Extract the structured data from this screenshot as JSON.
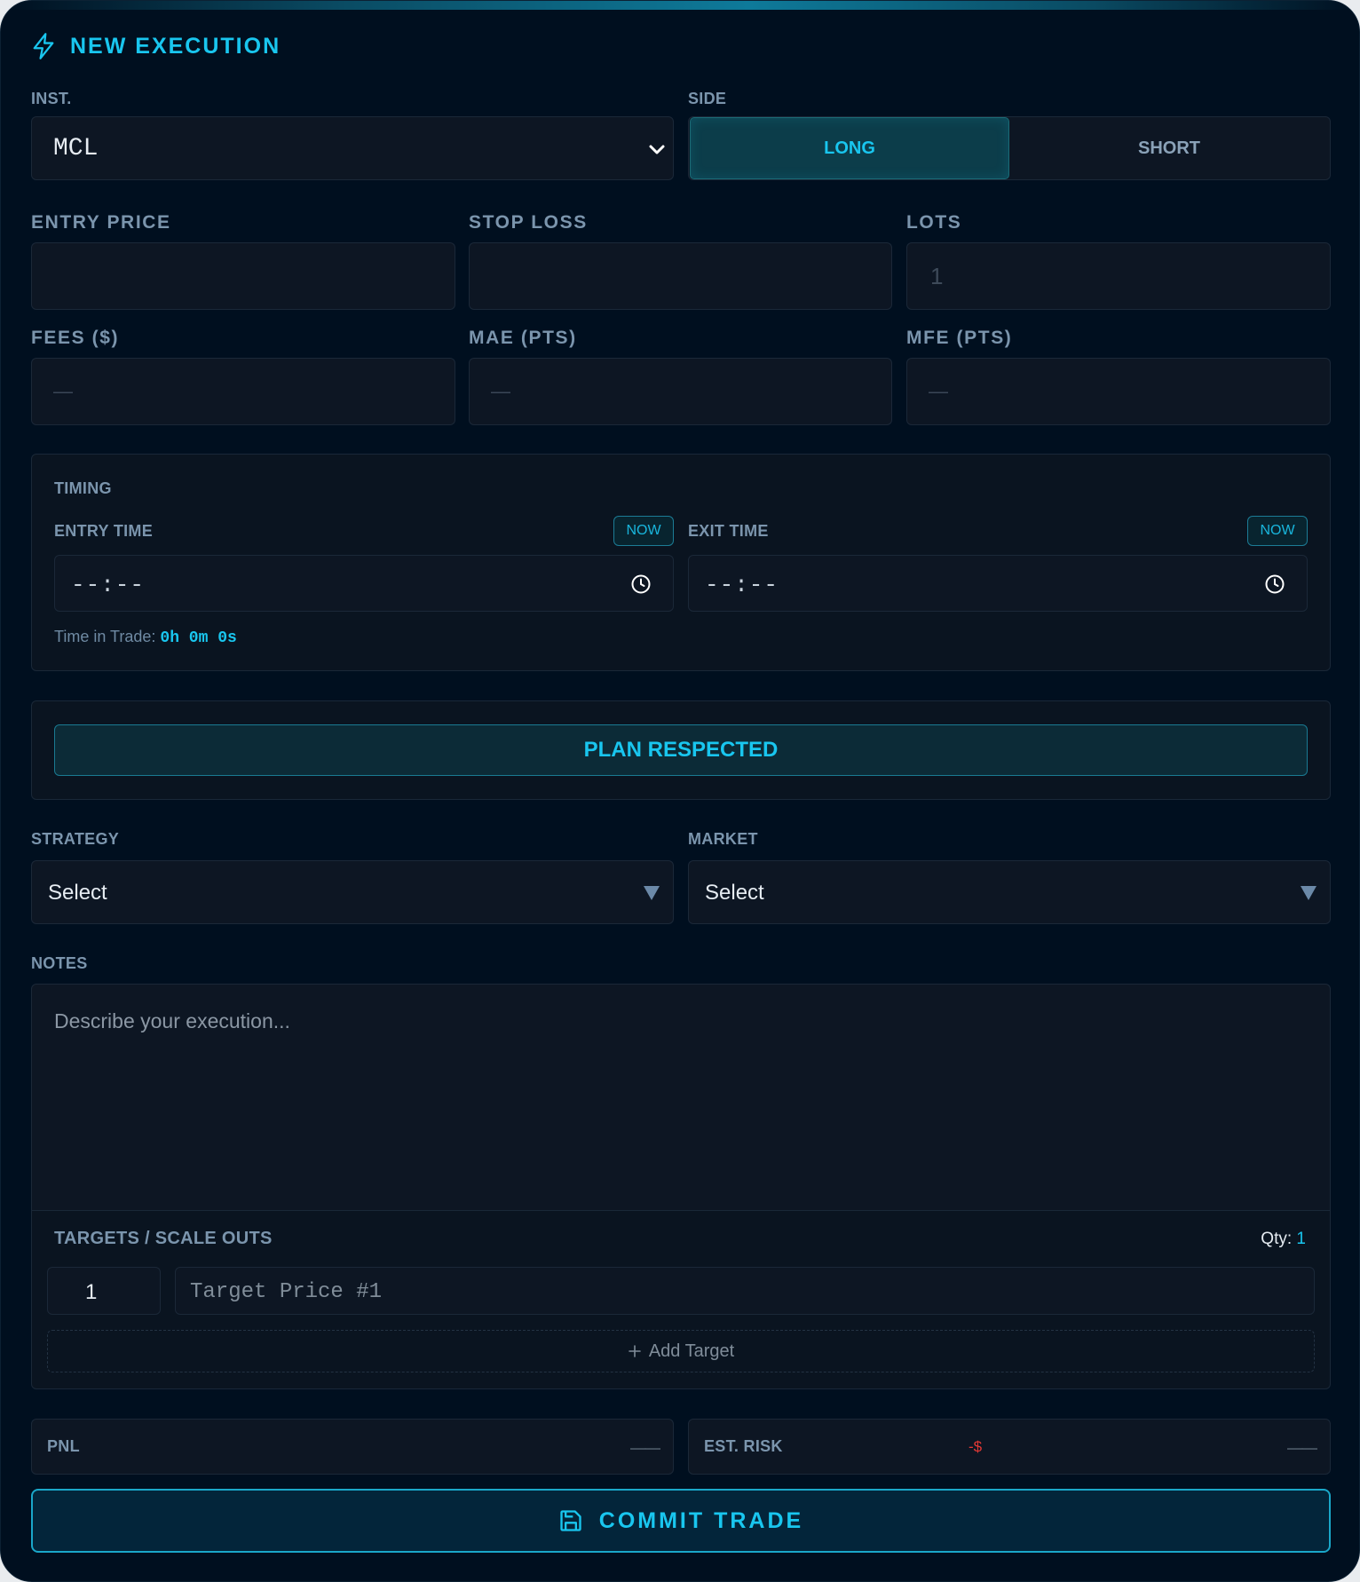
{
  "header": {
    "title": "NEW EXECUTION"
  },
  "instrument": {
    "label": "INST.",
    "value": "MCL"
  },
  "side": {
    "label": "SIDE",
    "long": "LONG",
    "short": "SHORT",
    "selected": "LONG"
  },
  "fields": {
    "entry_price": {
      "label": "ENTRY PRICE",
      "value": ""
    },
    "stop_loss": {
      "label": "STOP LOSS",
      "value": ""
    },
    "lots": {
      "label": "LOTS",
      "placeholder": "1"
    },
    "fees": {
      "label": "FEES ($)",
      "placeholder": "—"
    },
    "mae": {
      "label": "MAE (PTS)",
      "placeholder": "—"
    },
    "mfe": {
      "label": "MFE (PTS)",
      "placeholder": "—"
    }
  },
  "timing": {
    "title": "TIMING",
    "entry_label": "ENTRY TIME",
    "exit_label": "EXIT TIME",
    "now_label": "NOW",
    "entry_value": "--:--",
    "exit_value": "--:--",
    "time_in_trade_label": "Time in Trade:",
    "time_in_trade_value": "0h 0m 0s"
  },
  "plan": {
    "label": "PLAN RESPECTED"
  },
  "strategy": {
    "label": "STRATEGY",
    "value": "Select"
  },
  "market": {
    "label": "MARKET",
    "value": "Select"
  },
  "notes": {
    "label": "NOTES",
    "placeholder": "Describe your execution..."
  },
  "targets": {
    "title": "TARGETS / SCALE OUTS",
    "qty_label": "Qty:",
    "qty_value": "1",
    "rows": [
      {
        "qty": "1",
        "placeholder": "Target Price #1"
      }
    ],
    "add_label": "Add Target"
  },
  "pnl": {
    "label": "PNL",
    "value": "——"
  },
  "risk": {
    "label": "EST. RISK",
    "prefix": "-$",
    "value": "——"
  },
  "commit": {
    "label": "COMMIT TRADE"
  },
  "colors": {
    "accent": "#19c6ef",
    "background": "#000f1f",
    "field": "#0d1623",
    "danger": "#e53935"
  }
}
